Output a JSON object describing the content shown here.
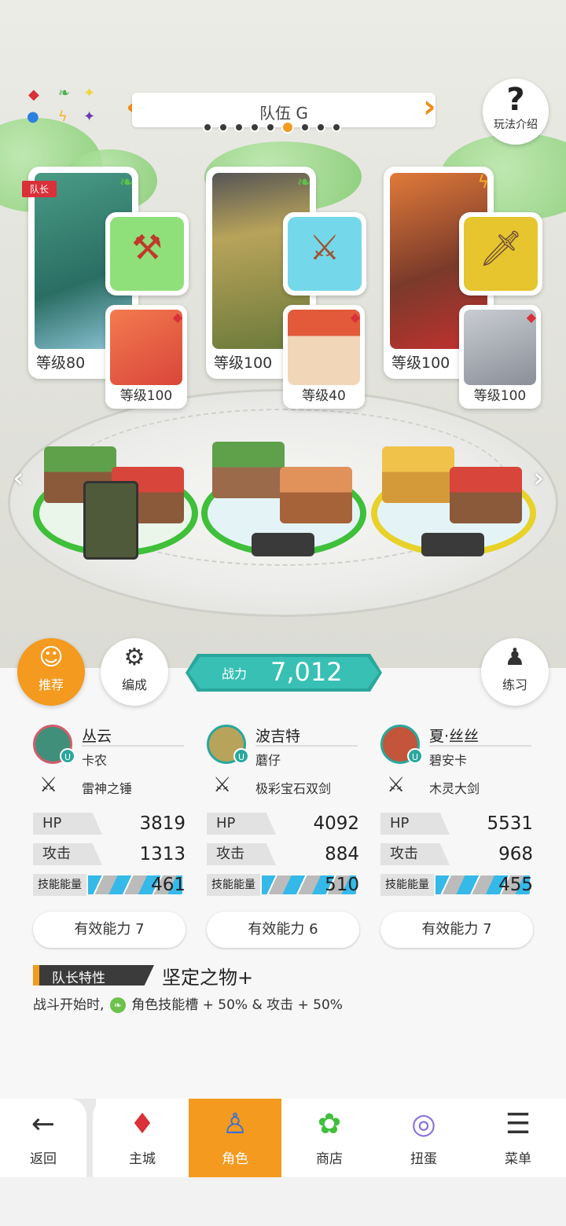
{
  "team": {
    "title": "队伍 G",
    "page_count": 9,
    "active_index": 5
  },
  "help": {
    "label": "玩法介绍"
  },
  "leader_tag": "队长",
  "characters": [
    {
      "level": "等级80",
      "element": "leaf",
      "weapon_color": "#7fd66b",
      "portrait_color": "#3f8f7a",
      "sub_level": "等级100",
      "sub_color": "#e5593c",
      "ring_color": "#3fbf3a"
    },
    {
      "level": "等级100",
      "element": "leaf",
      "weapon_color": "#62d0e8",
      "portrait_color": "#9b8a4a",
      "sub_level": "等级40",
      "sub_color": "#e9a27a",
      "ring_color": "#3fbf3a"
    },
    {
      "level": "等级100",
      "element": "bolt",
      "weapon_color": "#e8c23a",
      "portrait_color": "#c2553a",
      "sub_level": "等级100",
      "sub_color": "#9aa0a8",
      "ring_color": "#e8d22a"
    }
  ],
  "buttons": {
    "recommend": "推荐",
    "formation": "编成",
    "practice": "练习"
  },
  "power": {
    "label": "战力",
    "value": "7,012"
  },
  "members": [
    {
      "name": "丛云",
      "sub": "卡农",
      "weapon": "雷神之锤",
      "hp": "3819",
      "atk": "1313",
      "energy": "461",
      "effective": "有效能力 7"
    },
    {
      "name": "波吉特",
      "sub": "蘑仔",
      "weapon": "极彩宝石双剑",
      "hp": "4092",
      "atk": "884",
      "energy": "510",
      "effective": "有效能力 6"
    },
    {
      "name": "夏·丝丝",
      "sub": "碧安卡",
      "weapon": "木灵大剑",
      "hp": "5531",
      "atk": "968",
      "energy": "455",
      "effective": "有效能力 7"
    }
  ],
  "stat_labels": {
    "hp": "HP",
    "atk": "攻击",
    "energy": "技能能量"
  },
  "leader_trait": {
    "label": "队长特性",
    "name": "坚定之物+",
    "desc_prefix": "战斗开始时,",
    "desc_suffix": "角色技能槽 + 50% & 攻击 + 50%"
  },
  "nav": {
    "back": "返回",
    "tabs": [
      "主城",
      "角色",
      "商店",
      "扭蛋",
      "菜单"
    ],
    "active": "角色"
  }
}
